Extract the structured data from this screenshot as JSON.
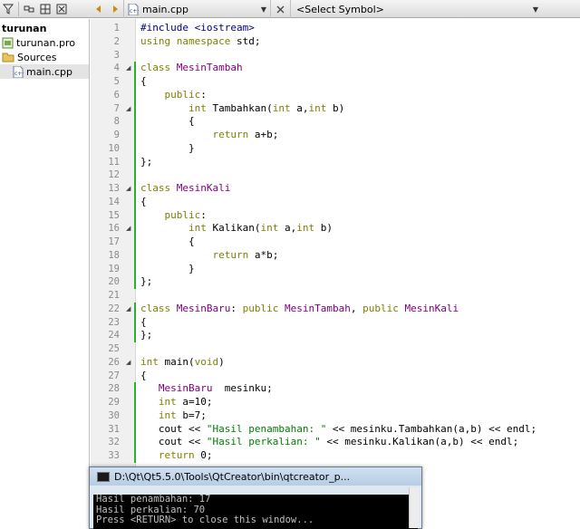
{
  "toolbar": {
    "file_combo": "main.cpp",
    "symbol_combo": "<Select Symbol>"
  },
  "sidebar": {
    "items": [
      {
        "label": "turunan",
        "icon": "project-icon"
      },
      {
        "label": "turunan.pro",
        "icon": "pro-file-icon"
      },
      {
        "label": "Sources",
        "icon": "folder-icon"
      },
      {
        "label": "main.cpp",
        "icon": "cpp-file-icon",
        "selected": true
      }
    ]
  },
  "editor": {
    "lines": [
      {
        "n": "1",
        "text": "#include <iostream>"
      },
      {
        "n": "2",
        "text": "using namespace std;"
      },
      {
        "n": "3",
        "text": ""
      },
      {
        "n": "4",
        "text": "class MesinTambah"
      },
      {
        "n": "5",
        "text": "{"
      },
      {
        "n": "6",
        "text": "    public:"
      },
      {
        "n": "7",
        "text": "        int Tambahkan(int a,int b)"
      },
      {
        "n": "8",
        "text": "        {"
      },
      {
        "n": "9",
        "text": "            return a+b;"
      },
      {
        "n": "10",
        "text": "        }"
      },
      {
        "n": "11",
        "text": "};"
      },
      {
        "n": "12",
        "text": ""
      },
      {
        "n": "13",
        "text": "class MesinKali"
      },
      {
        "n": "14",
        "text": "{"
      },
      {
        "n": "15",
        "text": "    public:"
      },
      {
        "n": "16",
        "text": "        int Kalikan(int a,int b)"
      },
      {
        "n": "17",
        "text": "        {"
      },
      {
        "n": "18",
        "text": "            return a*b;"
      },
      {
        "n": "19",
        "text": "        }"
      },
      {
        "n": "20",
        "text": "};"
      },
      {
        "n": "21",
        "text": ""
      },
      {
        "n": "22",
        "text": "class MesinBaru: public MesinTambah, public MesinKali"
      },
      {
        "n": "23",
        "text": "{"
      },
      {
        "n": "24",
        "text": "};"
      },
      {
        "n": "25",
        "text": ""
      },
      {
        "n": "26",
        "text": "int main(void)"
      },
      {
        "n": "27",
        "text": "{"
      },
      {
        "n": "28",
        "text": "   MesinBaru  mesinku;"
      },
      {
        "n": "29",
        "text": "   int a=10;"
      },
      {
        "n": "30",
        "text": "   int b=7;"
      },
      {
        "n": "31",
        "text": "   cout << \"Hasil penambahan: \" << mesinku.Tambahkan(a,b) << endl;"
      },
      {
        "n": "32",
        "text": "   cout << \"Hasil perkalian: \" << mesinku.Kalikan(a,b) << endl;"
      },
      {
        "n": "33",
        "text": "   return 0;"
      }
    ]
  },
  "console": {
    "title": "D:\\Qt\\Qt5.5.0\\Tools\\QtCreator\\bin\\qtcreator_p...",
    "lines": [
      "Hasil penambahan: 17",
      "Hasil perkalian: 70",
      "Press <RETURN> to close this window..."
    ]
  },
  "colors": {
    "keyword": "#808000",
    "preprocessor": "#000080",
    "type": "#800080",
    "string": "#008000",
    "change_marker": "#2ab32a"
  }
}
